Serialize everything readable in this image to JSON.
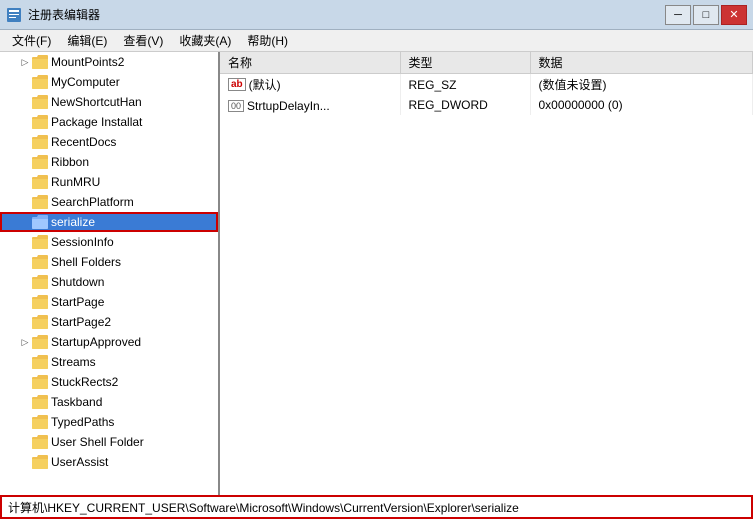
{
  "window": {
    "title": "注册表编辑器",
    "icon": "regedit-icon"
  },
  "titlebar": {
    "minimize": "─",
    "maximize": "□",
    "close": "✕"
  },
  "menubar": {
    "items": [
      "文件(F)",
      "编辑(E)",
      "查看(V)",
      "收藏夹(A)",
      "帮助(H)"
    ]
  },
  "tree": {
    "items": [
      {
        "id": "MountPoints2",
        "label": "MountPoints2",
        "indent": 1,
        "has_expand": true
      },
      {
        "id": "MyComputer",
        "label": "MyComputer",
        "indent": 1,
        "has_expand": false
      },
      {
        "id": "NewShortcutHan",
        "label": "NewShortcutHan",
        "indent": 1,
        "has_expand": false
      },
      {
        "id": "Package Installat",
        "label": "Package Installat",
        "indent": 1,
        "has_expand": false
      },
      {
        "id": "RecentDocs",
        "label": "RecentDocs",
        "indent": 1,
        "has_expand": false
      },
      {
        "id": "Ribbon",
        "label": "Ribbon",
        "indent": 1,
        "has_expand": false
      },
      {
        "id": "RunMRU",
        "label": "RunMRU",
        "indent": 1,
        "has_expand": false
      },
      {
        "id": "SearchPlatform",
        "label": "SearchPlatform",
        "indent": 1,
        "has_expand": false
      },
      {
        "id": "serialize",
        "label": "serialize",
        "indent": 1,
        "has_expand": false,
        "selected": true
      },
      {
        "id": "SessionInfo",
        "label": "SessionInfo",
        "indent": 1,
        "has_expand": false
      },
      {
        "id": "Shell Folders",
        "label": "Shell Folders",
        "indent": 1,
        "has_expand": false
      },
      {
        "id": "Shutdown",
        "label": "Shutdown",
        "indent": 1,
        "has_expand": false
      },
      {
        "id": "StartPage",
        "label": "StartPage",
        "indent": 1,
        "has_expand": false
      },
      {
        "id": "StartPage2",
        "label": "StartPage2",
        "indent": 1,
        "has_expand": false
      },
      {
        "id": "StartupApproved",
        "label": "StartupApproved",
        "indent": 1,
        "has_expand": true
      },
      {
        "id": "Streams",
        "label": "Streams",
        "indent": 1,
        "has_expand": false
      },
      {
        "id": "StuckRects2",
        "label": "StuckRects2",
        "indent": 1,
        "has_expand": false
      },
      {
        "id": "Taskband",
        "label": "Taskband",
        "indent": 1,
        "has_expand": false
      },
      {
        "id": "TypedPaths",
        "label": "TypedPaths",
        "indent": 1,
        "has_expand": false
      },
      {
        "id": "User Shell Folder",
        "label": "User Shell Folder",
        "indent": 1,
        "has_expand": false
      },
      {
        "id": "UserAssist",
        "label": "UserAssist",
        "indent": 1,
        "has_expand": false
      }
    ]
  },
  "table": {
    "columns": [
      "名称",
      "类型",
      "数据"
    ],
    "rows": [
      {
        "name": "(默认)",
        "type": "REG_SZ",
        "data": "(数值未设置)",
        "icon": "ab-icon"
      },
      {
        "name": "StrtupDelayIn...",
        "type": "REG_DWORD",
        "data": "0x00000000 (0)",
        "icon": "hex-icon"
      }
    ]
  },
  "statusbar": {
    "path": "计算机\\HKEY_CURRENT_USER\\Software\\Microsoft\\Windows\\CurrentVersion\\Explorer\\serialize"
  },
  "colors": {
    "accent": "#3399ff",
    "selected_bg": "#3a7bd5",
    "folder_yellow": "#f0c050",
    "status_border": "#cc0000",
    "title_bg": "#c8d8e8"
  }
}
